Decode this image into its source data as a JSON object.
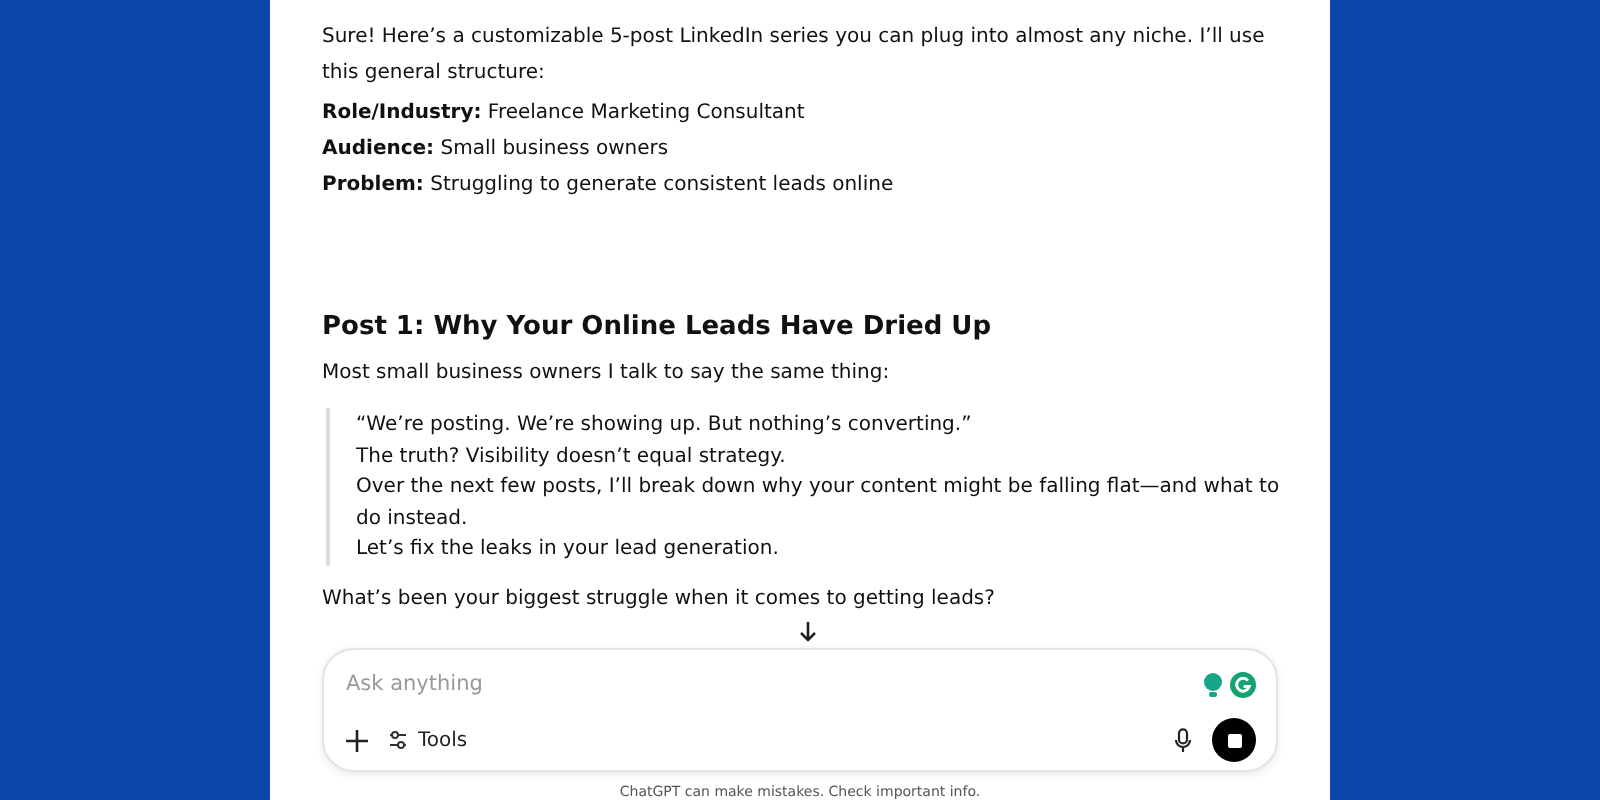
{
  "intro": "Sure! Here’s a customizable 5-post LinkedIn series you can plug into almost any niche. I’ll use this general structure:",
  "details": [
    {
      "label": "Role/Industry:",
      "value": "Freelance Marketing Consultant"
    },
    {
      "label": "Audience:",
      "value": "Small business owners"
    },
    {
      "label": "Problem:",
      "value": "Struggling to generate consistent leads online"
    }
  ],
  "post": {
    "heading": "Post 1: Why Your Online Leads Have Dried Up",
    "lead": "Most small business owners I talk to say the same thing:",
    "quote": [
      "“We’re posting. We’re showing up. But nothing’s converting.”",
      "The truth? Visibility doesn’t equal strategy.",
      "Over the next few posts, I’ll break down why your content might be falling flat—and what to do instead.",
      "Let’s fix the leaks in your lead generation."
    ],
    "question": "What’s been your biggest struggle when it comes to getting leads?"
  },
  "composer": {
    "placeholder": "Ask anything",
    "tools_label": "Tools"
  },
  "footer": "ChatGPT can make mistakes. Check important info."
}
